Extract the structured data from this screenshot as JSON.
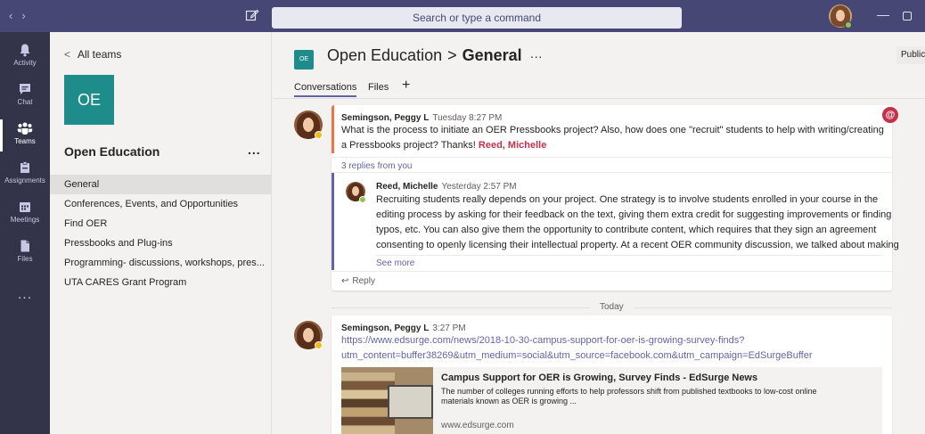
{
  "window": {
    "search_placeholder": "Search or type a command",
    "back_glyph": "‹",
    "forward_glyph": "›",
    "minimize_glyph": "—"
  },
  "appbar": {
    "items": [
      {
        "label": "Activity",
        "icon": "bell-icon"
      },
      {
        "label": "Chat",
        "icon": "chat-icon"
      },
      {
        "label": "Teams",
        "icon": "teams-icon"
      },
      {
        "label": "Assignments",
        "icon": "assignments-icon"
      },
      {
        "label": "Meetings",
        "icon": "calendar-icon"
      },
      {
        "label": "Files",
        "icon": "file-icon"
      }
    ],
    "active": "Teams",
    "more": "..."
  },
  "teams_panel": {
    "back_label": "All teams",
    "back_glyph": "<",
    "team_avatar": "OE",
    "team_name": "Open Education",
    "team_more": "...",
    "channels": [
      "General",
      "Conferences, Events, and Opportunities",
      "Find OER",
      "Pressbooks and Plug-ins",
      "Programming- discussions, workshops, pres...",
      "UTA CARES Grant Program"
    ],
    "active_channel": "General"
  },
  "channel_header": {
    "avatar": "OE",
    "team": "Open Education",
    "separator": ">",
    "channel": "General",
    "more": "···",
    "badge": "Public",
    "tabs": [
      "Conversations",
      "Files"
    ],
    "add_tab": "+"
  },
  "thread1": {
    "sender": "Semingson, Peggy L",
    "time": "Tuesday 8:27 PM",
    "line1": "What is the process to initiate an OER Pressbooks project? Also, how does one \"recruit\" students to help with writing/creating",
    "line2": "a Pressbooks project? Thanks! ",
    "mention": "Reed, Michelle",
    "mention_badge": "@",
    "replies_label": "3 replies from you",
    "reply": {
      "sender": "Reed, Michelle",
      "time": "Yesterday 2:57 PM",
      "lines": [
        "Recruiting students really depends on your project. One strategy is to involve students enrolled in your course in the",
        "editing process by asking for their feedback on the text, giving them extra credit for suggesting improvements or finding",
        "typos, etc. You can also give them the opportunity to contribute content, which requires that they sign an agreement",
        "consenting to openly licensing their intellectual property. At a recent OER community discussion, we talked about making"
      ],
      "see_more": "See more"
    },
    "reply_action": "Reply",
    "reply_glyph": "↩"
  },
  "day_divider": "Today",
  "thread2": {
    "sender": "Semingson, Peggy L",
    "time": "3:27 PM",
    "link_line1": "https://www.edsurge.com/news/2018-10-30-campus-support-for-oer-is-growing-survey-finds?",
    "link_line2": "utm_content=buffer38269&utm_medium=social&utm_source=facebook.com&utm_campaign=EdSurgeBuffer",
    "preview": {
      "title": "Campus Support for OER is Growing, Survey Finds - EdSurge News",
      "desc_line1": "The number of colleges running efforts to help professors shift from published textbooks to low-cost online",
      "desc_line2": "materials known as OER is growing ...",
      "domain": "www.edsurge.com"
    }
  },
  "colors": {
    "titlebar": "#464775",
    "appbar": "#33344a",
    "accent": "#6264a7",
    "team_teal": "#1f8c8c",
    "mention_red": "#c4314b",
    "thread_orange": "#e97548"
  }
}
